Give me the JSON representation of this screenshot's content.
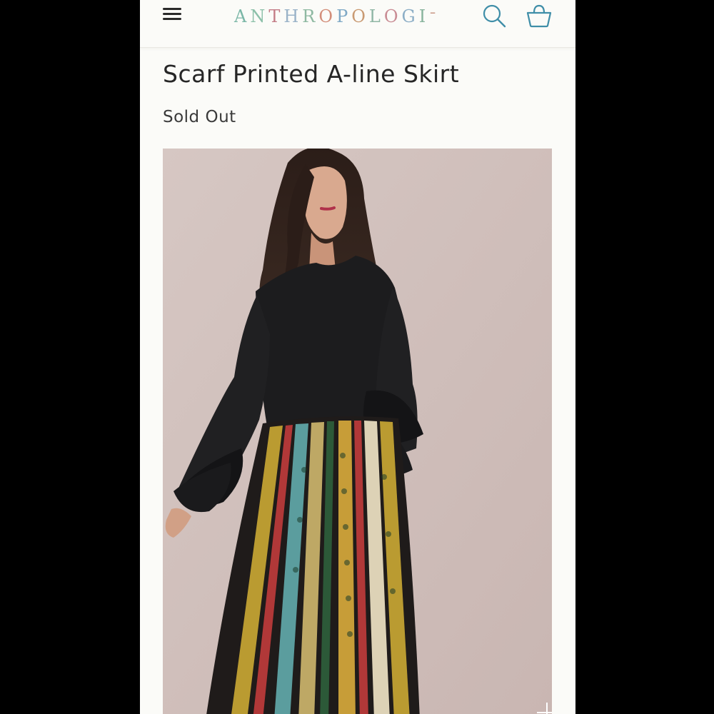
{
  "header": {
    "menu_icon": "hamburger-menu-icon",
    "logo_letters": [
      {
        "ch": "A",
        "color": "#7bb7a7"
      },
      {
        "ch": "N",
        "color": "#8cc0a9"
      },
      {
        "ch": "T",
        "color": "#c37c86"
      },
      {
        "ch": "H",
        "color": "#9ab3c8"
      },
      {
        "ch": "R",
        "color": "#8fb9a2"
      },
      {
        "ch": "O",
        "color": "#d38e7a"
      },
      {
        "ch": "P",
        "color": "#7fa9c6"
      },
      {
        "ch": "O",
        "color": "#c99a72"
      },
      {
        "ch": "L",
        "color": "#8fb6a4"
      },
      {
        "ch": "O",
        "color": "#c98c94"
      },
      {
        "ch": "G",
        "color": "#8caec6"
      },
      {
        "ch": "I",
        "color": "#87b39c"
      },
      {
        "ch": "ᐨ",
        "color": "#c48e7a"
      }
    ],
    "search_icon": "search-icon",
    "bag_icon": "shopping-bag-icon",
    "accent_color": "#3f8ea8"
  },
  "product": {
    "title": "Scarf Printed A-line Skirt",
    "status": "Sold Out"
  },
  "image": {
    "alt": "model-photo",
    "zoom_icon": "plus-icon"
  }
}
